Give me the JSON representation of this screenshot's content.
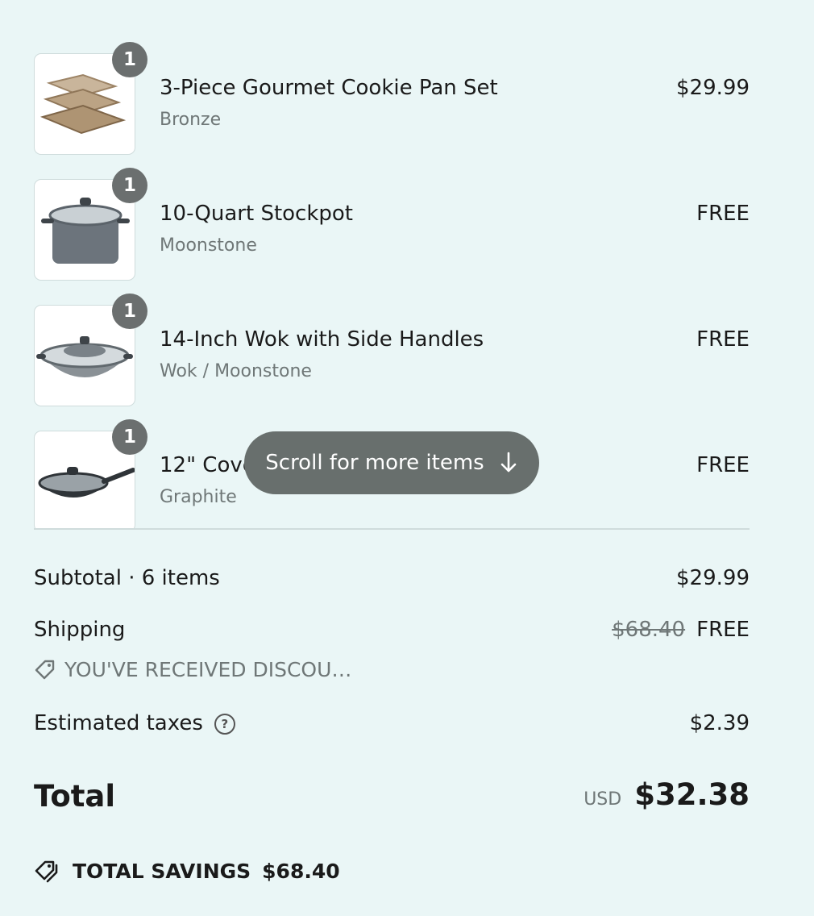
{
  "cart": {
    "items": [
      {
        "quantity": "1",
        "name": "3-Piece Gourmet Cookie Pan Set",
        "variant": "Bronze",
        "price": "$29.99",
        "image_icon": "cookie-pan-set-icon"
      },
      {
        "quantity": "1",
        "name": "10-Quart Stockpot",
        "variant": "Moonstone",
        "price": "FREE",
        "image_icon": "stockpot-icon"
      },
      {
        "quantity": "1",
        "name": "14-Inch Wok with Side Handles",
        "variant": "Wok / Moonstone",
        "price": "FREE",
        "image_icon": "wok-icon"
      },
      {
        "quantity": "1",
        "name": "12\" Cove",
        "variant": "Graphite",
        "price": "FREE",
        "image_icon": "covered-pan-icon"
      }
    ],
    "scroll_hint": "Scroll for more items",
    "scroll_icon": "arrow-down-icon"
  },
  "summary": {
    "subtotal_label": "Subtotal · 6 items",
    "subtotal_value": "$29.99",
    "shipping_label": "Shipping",
    "shipping_original": "$68.40",
    "shipping_value": "FREE",
    "discount_text": "YOU'VE RECEIVED DISCOU…",
    "discount_icon": "tag-icon",
    "taxes_label": "Estimated taxes",
    "taxes_value": "$2.39",
    "total_label": "Total",
    "currency": "USD",
    "total_value": "$32.38",
    "savings_icon": "tags-icon",
    "savings_label": "TOTAL SAVINGS",
    "savings_value": "$68.40"
  },
  "colors": {
    "background": "#eaf6f6",
    "pill": "#686f6d",
    "badge": "#6b6f6f",
    "muted": "#6f7777"
  }
}
